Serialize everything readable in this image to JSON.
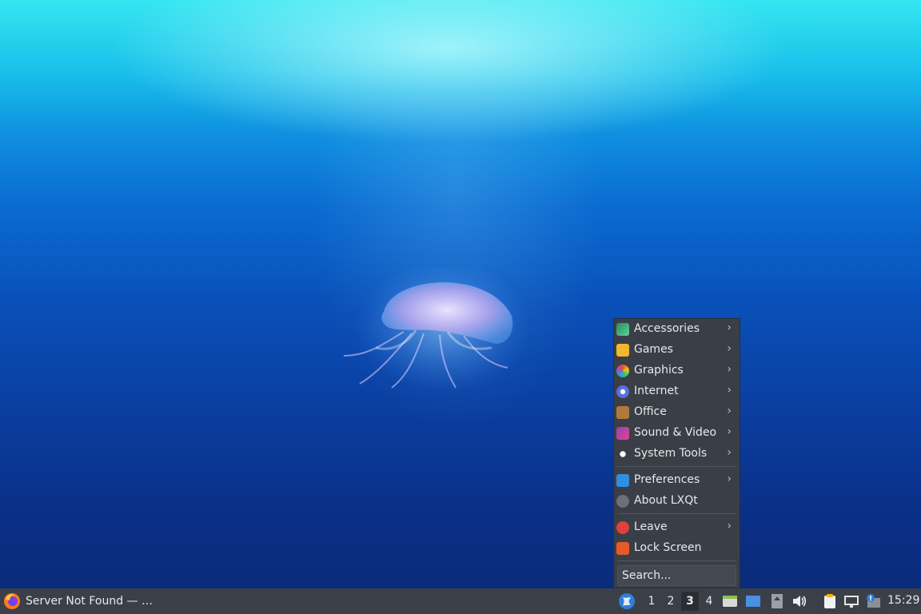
{
  "menu": {
    "items": [
      {
        "label": "Accessories",
        "icon": "accessories-icon",
        "submenu": true
      },
      {
        "label": "Games",
        "icon": "games-icon",
        "submenu": true
      },
      {
        "label": "Graphics",
        "icon": "graphics-icon",
        "submenu": true
      },
      {
        "label": "Internet",
        "icon": "internet-icon",
        "submenu": true
      },
      {
        "label": "Office",
        "icon": "office-icon",
        "submenu": true
      },
      {
        "label": "Sound & Video",
        "icon": "sound-video-icon",
        "submenu": true
      },
      {
        "label": "System Tools",
        "icon": "system-tools-icon",
        "submenu": true
      },
      {
        "label": "Preferences",
        "icon": "preferences-icon",
        "submenu": true
      },
      {
        "label": "About LXQt",
        "icon": "info-icon",
        "submenu": false
      },
      {
        "label": "Leave",
        "icon": "power-icon",
        "submenu": true
      },
      {
        "label": "Lock Screen",
        "icon": "lock-icon",
        "submenu": false
      }
    ],
    "arrow": "›",
    "search_placeholder": "Search..."
  },
  "taskbar": {
    "window_title": "Server Not Found — …",
    "workspaces": [
      "1",
      "2",
      "3",
      "4"
    ],
    "active_workspace": "3",
    "clock": "15:29"
  },
  "colors": {
    "menu_bg": "#3a3f47",
    "taskbar_bg": "#3b4048",
    "accent_blue": "#2f7fd8"
  }
}
